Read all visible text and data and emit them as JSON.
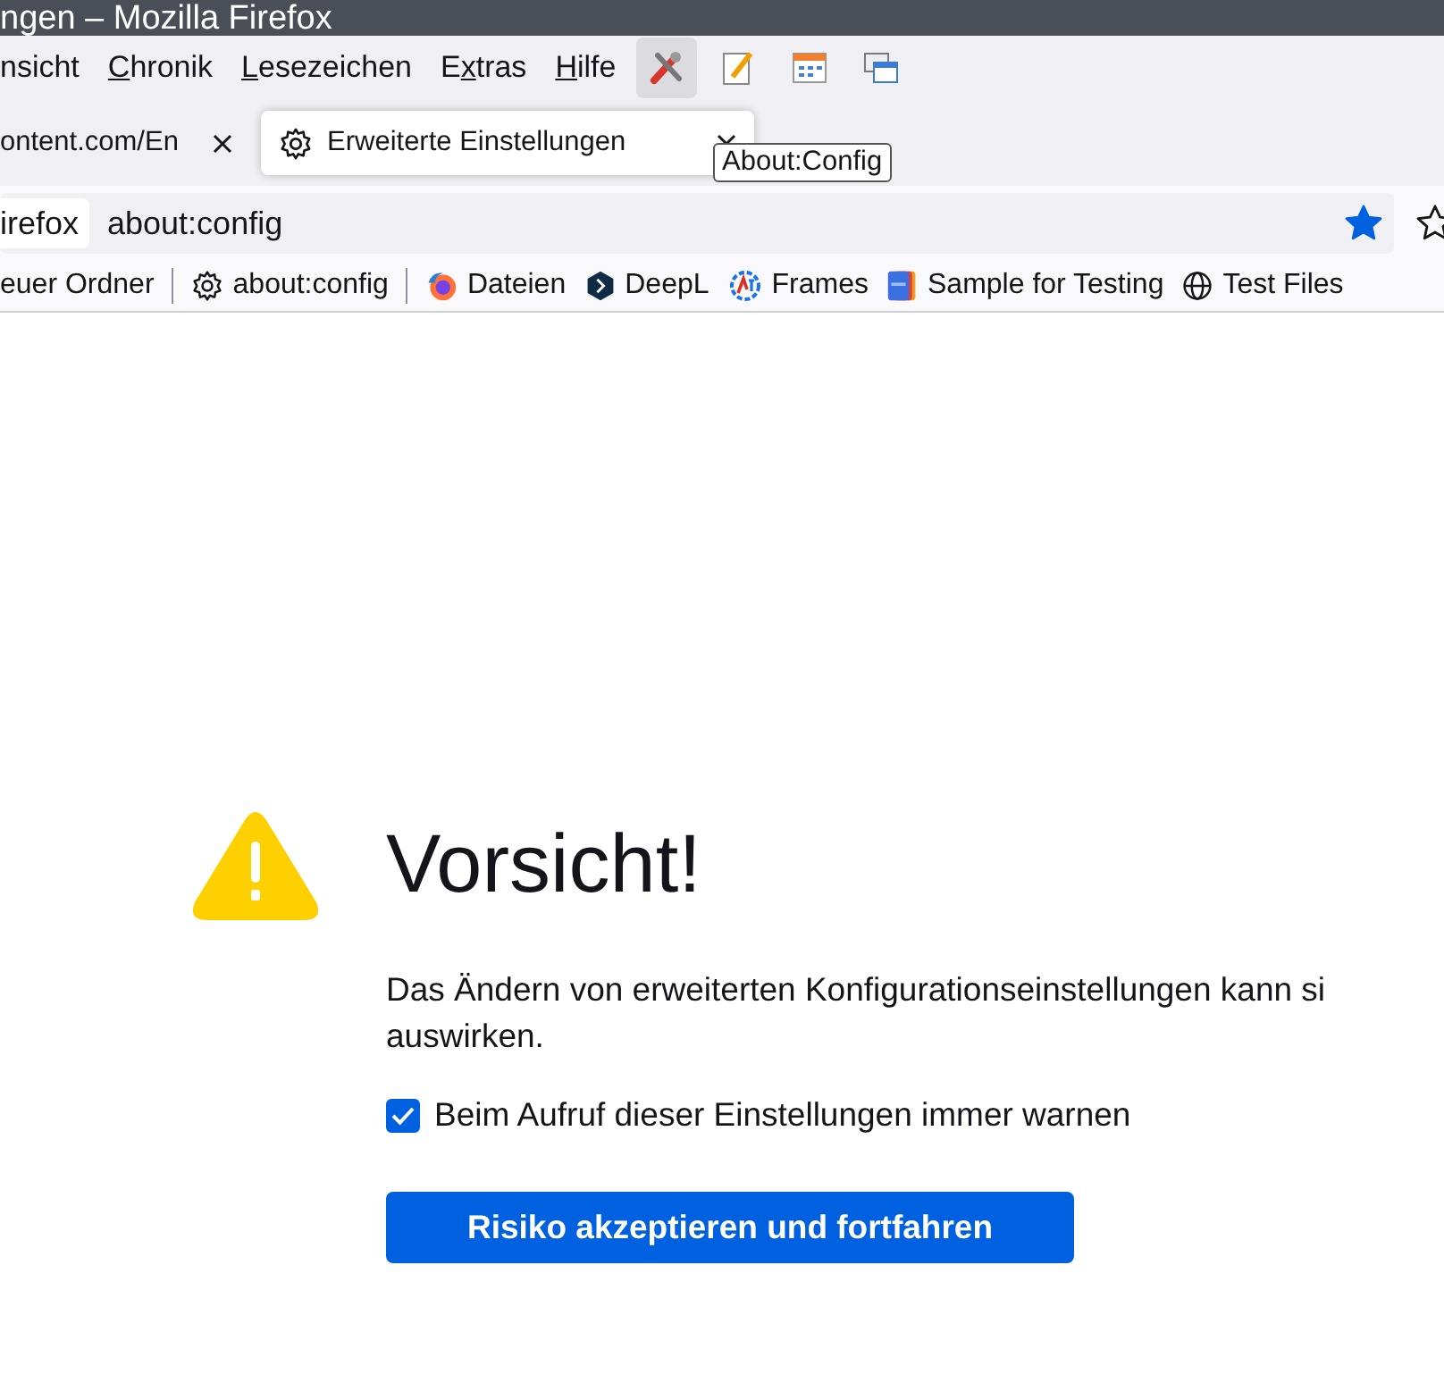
{
  "window": {
    "title": "ngen – Mozilla Firefox"
  },
  "menu": [
    {
      "before": "nsicht"
    },
    {
      "key": "C",
      "after": "hronik"
    },
    {
      "key": "L",
      "after": "esezeichen"
    },
    {
      "before": "E",
      "key": "x",
      "after": "tras"
    },
    {
      "key": "H",
      "after": "ilfe"
    }
  ],
  "toolbar_buttons": [
    {
      "kind": "tools",
      "hovered": true
    },
    {
      "kind": "notepad",
      "hovered": false
    },
    {
      "kind": "calendar",
      "hovered": false
    },
    {
      "kind": "windows",
      "hovered": false
    }
  ],
  "tabs": [
    {
      "label": "ontent.com/En",
      "selected": false,
      "kind": "page"
    },
    {
      "label": "Erweiterte Einstellungen",
      "selected": true,
      "kind": "settings"
    }
  ],
  "tooltip": "About:Config",
  "urlbar": {
    "identity": "irefox",
    "value": "about:config",
    "bookmarked": true
  },
  "bookmarks": [
    {
      "label": "euer Ordner",
      "kind": "none"
    },
    {
      "kind": "separator"
    },
    {
      "label": "about:config",
      "kind": "gear"
    },
    {
      "kind": "separator"
    },
    {
      "label": "Dateien",
      "kind": "firefox"
    },
    {
      "label": "DeepL",
      "kind": "deepl"
    },
    {
      "label": "Frames",
      "kind": "frames"
    },
    {
      "label": "Sample for Testing",
      "kind": "sample"
    },
    {
      "label": "Test Files",
      "kind": "globe"
    }
  ],
  "warning": {
    "heading": "Vorsicht!",
    "text_lines": [
      "Das Ändern von erweiterten Konfigurationseinstellungen kann si",
      "auswirken."
    ],
    "checkbox": {
      "label": "Beim Aufruf dieser Einstellungen immer warnen",
      "checked": true
    },
    "button": "Risiko akzeptieren und fortfahren"
  }
}
